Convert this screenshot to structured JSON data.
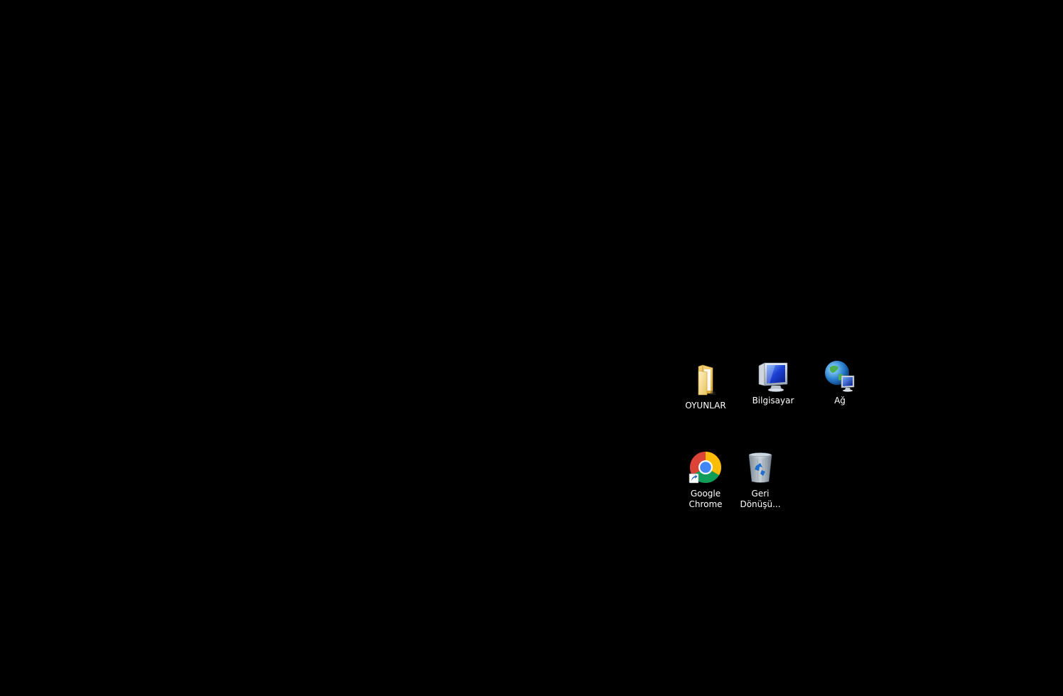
{
  "desktop": {
    "background_color": "#000000",
    "icons": [
      {
        "label": "OYUNLAR",
        "icon": "folder-icon"
      },
      {
        "label": "Bilgisayar",
        "icon": "computer-icon"
      },
      {
        "label": "Ağ",
        "icon": "network-icon"
      },
      {
        "label": "Google Chrome",
        "icon": "chrome-icon"
      },
      {
        "label": "Geri Dönüşü...",
        "icon": "recycle-bin-icon"
      }
    ]
  }
}
